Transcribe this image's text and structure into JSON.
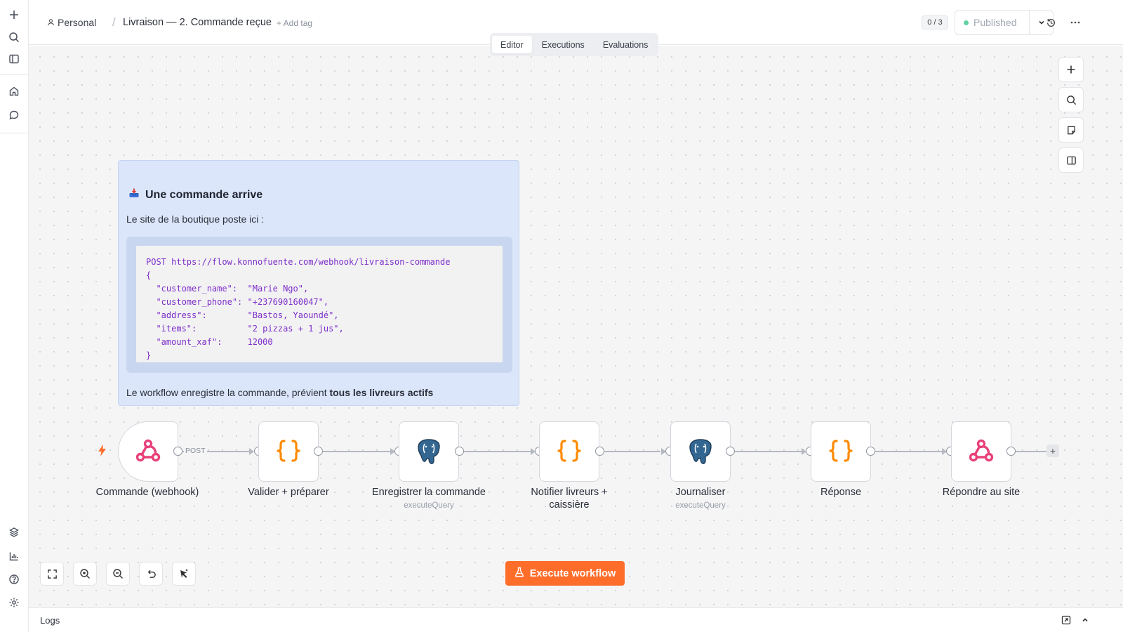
{
  "breadcrumb": {
    "project": "Personal",
    "separator": "/",
    "workflow_title": "Livraison — 2. Commande reçue",
    "add_tag": "+ Add tag"
  },
  "header": {
    "counter": "0 / 3",
    "publish_label": "Published"
  },
  "tabs": [
    {
      "label": "Editor"
    },
    {
      "label": "Executions"
    },
    {
      "label": "Evaluations"
    }
  ],
  "sticky": {
    "title": "Une commande arrive",
    "intro": "Le site de la boutique poste ici :",
    "code": "POST https://flow.konnofuente.com/webhook/livraison-commande\n{\n  \"customer_name\":  \"Marie Ngo\",\n  \"customer_phone\": \"+237690160047\",\n  \"address\":        \"Bastos, Yaoundé\",\n  \"items\":          \"2 pizzas + 1 jus\",\n  \"amount_xaf\":     12000\n}",
    "outro_prefix": "Le workflow enregistre la commande, prévient ",
    "outro_bold": "tous les livreurs actifs"
  },
  "nodes": [
    {
      "label": "Commande (webhook)",
      "sub": "",
      "icon": "webhook-icon"
    },
    {
      "label": "Valider + préparer",
      "sub": "",
      "icon": "code-braces-icon"
    },
    {
      "label": "Enregistrer la commande",
      "sub": "executeQuery",
      "icon": "postgres-icon"
    },
    {
      "label": "Notifier livreurs + caissière",
      "sub": "",
      "icon": "code-braces-icon"
    },
    {
      "label": "Journaliser",
      "sub": "executeQuery",
      "icon": "postgres-icon"
    },
    {
      "label": "Réponse",
      "sub": "",
      "icon": "code-braces-icon"
    },
    {
      "label": "Répondre au site",
      "sub": "",
      "icon": "webhook-icon"
    }
  ],
  "edge_label": "POST",
  "execute_button": "Execute workflow",
  "logs_label": "Logs",
  "colors": {
    "accent": "#ff6d2b",
    "webhook": "#e8407a",
    "code": "#ff8a00",
    "published_dot": "#5fd3a6"
  }
}
